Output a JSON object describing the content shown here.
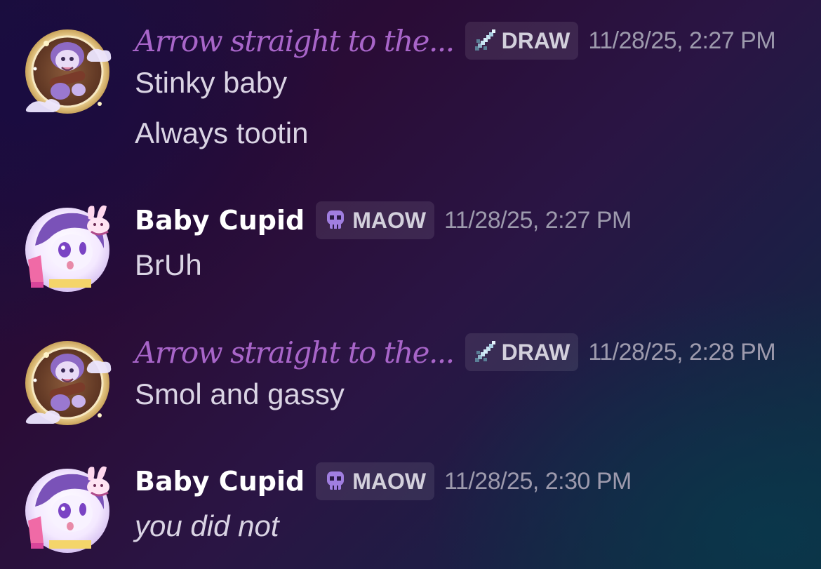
{
  "messages": [
    {
      "author": "Arrow straight to the...",
      "author_style": "fancy",
      "tag": {
        "label": "DRAW",
        "icon": "sword-icon"
      },
      "timestamp": "11/28/25, 2:27 PM",
      "lines": [
        "Stinky baby",
        "Always tootin"
      ]
    },
    {
      "author": "Baby Cupid",
      "author_style": "bold",
      "tag": {
        "label": "MAOW",
        "icon": "skull-icon"
      },
      "timestamp": "11/28/25, 2:27 PM",
      "lines": [
        "BrUh"
      ]
    },
    {
      "author": "Arrow straight to the...",
      "author_style": "fancy",
      "tag": {
        "label": "DRAW",
        "icon": "sword-icon"
      },
      "timestamp": "11/28/25, 2:28 PM",
      "lines": [
        "Smol and gassy"
      ]
    },
    {
      "author": "Baby Cupid",
      "author_style": "bold",
      "tag": {
        "label": "MAOW",
        "icon": "skull-icon"
      },
      "timestamp": "11/28/25, 2:30 PM",
      "lines": [
        "you did not"
      ]
    }
  ],
  "colors": {
    "fancy_name": "#a865c9",
    "bold_name": "#ffffff",
    "timestamp": "#9d9aad",
    "message_text": "#dad4e4",
    "tag_bg": "rgba(255,255,255,0.09)"
  }
}
